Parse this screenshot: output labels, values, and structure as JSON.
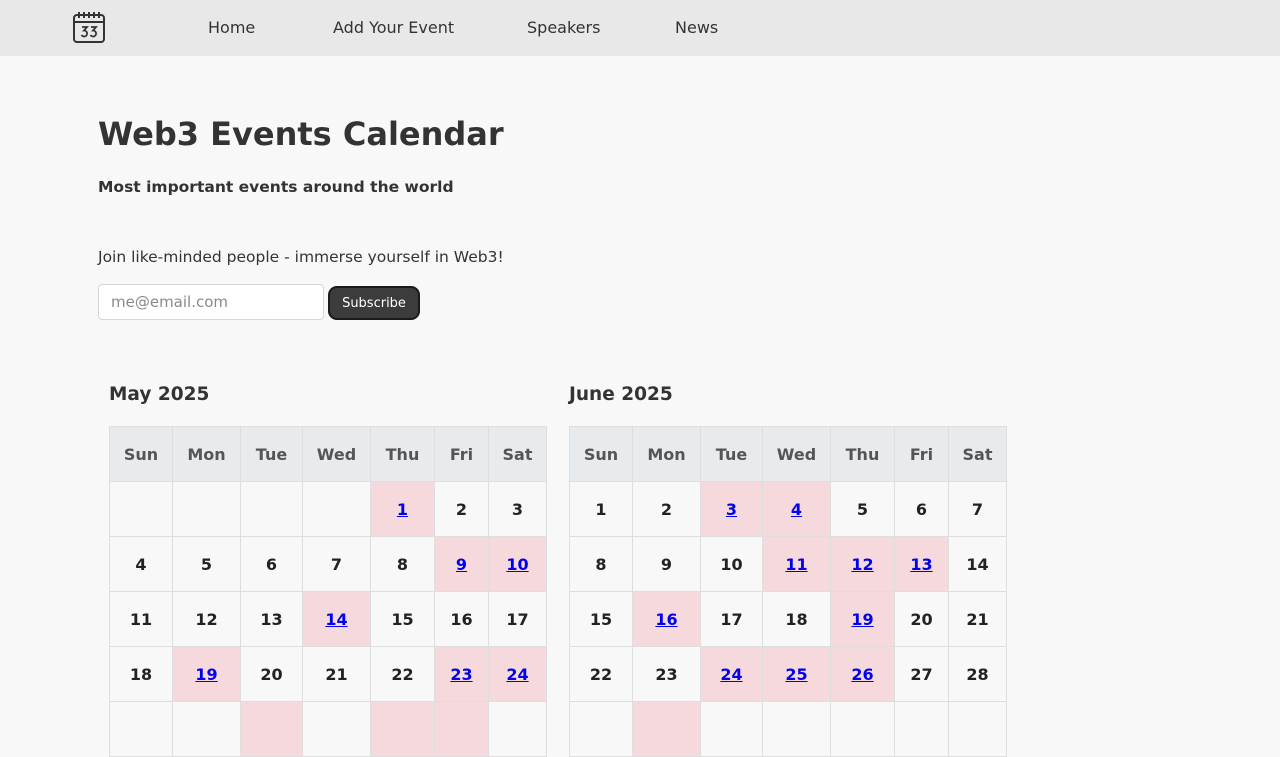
{
  "nav": {
    "logo_icon": "calendar-icon",
    "items": [
      {
        "label": "Home"
      },
      {
        "label": "Add Your Event"
      },
      {
        "label": "Speakers"
      },
      {
        "label": "News"
      }
    ]
  },
  "hero": {
    "title": "Web3 Events Calendar",
    "subtitle": "Most important events around the world"
  },
  "subscribe": {
    "text": "Join like-minded people - immerse yourself in Web3!",
    "placeholder": "me@email.com",
    "value": "",
    "button_label": "Subscribe"
  },
  "calendars": [
    {
      "title": "May 2025",
      "weekdays": [
        "Sun",
        "Mon",
        "Tue",
        "Wed",
        "Thu",
        "Fri",
        "Sat"
      ],
      "rows": [
        [
          {
            "day": ""
          },
          {
            "day": ""
          },
          {
            "day": ""
          },
          {
            "day": ""
          },
          {
            "day": "1",
            "event": true
          },
          {
            "day": "2"
          },
          {
            "day": "3"
          }
        ],
        [
          {
            "day": "4"
          },
          {
            "day": "5"
          },
          {
            "day": "6"
          },
          {
            "day": "7"
          },
          {
            "day": "8"
          },
          {
            "day": "9",
            "event": true
          },
          {
            "day": "10",
            "event": true
          }
        ],
        [
          {
            "day": "11"
          },
          {
            "day": "12"
          },
          {
            "day": "13"
          },
          {
            "day": "14",
            "event": true
          },
          {
            "day": "15"
          },
          {
            "day": "16"
          },
          {
            "day": "17"
          }
        ],
        [
          {
            "day": "18"
          },
          {
            "day": "19",
            "event": true
          },
          {
            "day": "20"
          },
          {
            "day": "21"
          },
          {
            "day": "22"
          },
          {
            "day": "23",
            "event": true
          },
          {
            "day": "24",
            "event": true
          }
        ],
        [
          {
            "day": ""
          },
          {
            "day": ""
          },
          {
            "day": "",
            "event": true
          },
          {
            "day": ""
          },
          {
            "day": "",
            "event": true
          },
          {
            "day": "",
            "event": true
          },
          {
            "day": ""
          }
        ]
      ]
    },
    {
      "title": "June 2025",
      "weekdays": [
        "Sun",
        "Mon",
        "Tue",
        "Wed",
        "Thu",
        "Fri",
        "Sat"
      ],
      "rows": [
        [
          {
            "day": "1"
          },
          {
            "day": "2"
          },
          {
            "day": "3",
            "event": true
          },
          {
            "day": "4",
            "event": true
          },
          {
            "day": "5"
          },
          {
            "day": "6"
          },
          {
            "day": "7"
          }
        ],
        [
          {
            "day": "8"
          },
          {
            "day": "9"
          },
          {
            "day": "10"
          },
          {
            "day": "11",
            "event": true
          },
          {
            "day": "12",
            "event": true
          },
          {
            "day": "13",
            "event": true
          },
          {
            "day": "14"
          }
        ],
        [
          {
            "day": "15"
          },
          {
            "day": "16",
            "event": true
          },
          {
            "day": "17"
          },
          {
            "day": "18"
          },
          {
            "day": "19",
            "event": true
          },
          {
            "day": "20"
          },
          {
            "day": "21"
          }
        ],
        [
          {
            "day": "22"
          },
          {
            "day": "23"
          },
          {
            "day": "24",
            "event": true
          },
          {
            "day": "25",
            "event": true
          },
          {
            "day": "26",
            "event": true
          },
          {
            "day": "27"
          },
          {
            "day": "28"
          }
        ],
        [
          {
            "day": ""
          },
          {
            "day": "",
            "event": true
          },
          {
            "day": ""
          },
          {
            "day": ""
          },
          {
            "day": ""
          },
          {
            "day": ""
          },
          {
            "day": ""
          }
        ]
      ]
    }
  ]
}
